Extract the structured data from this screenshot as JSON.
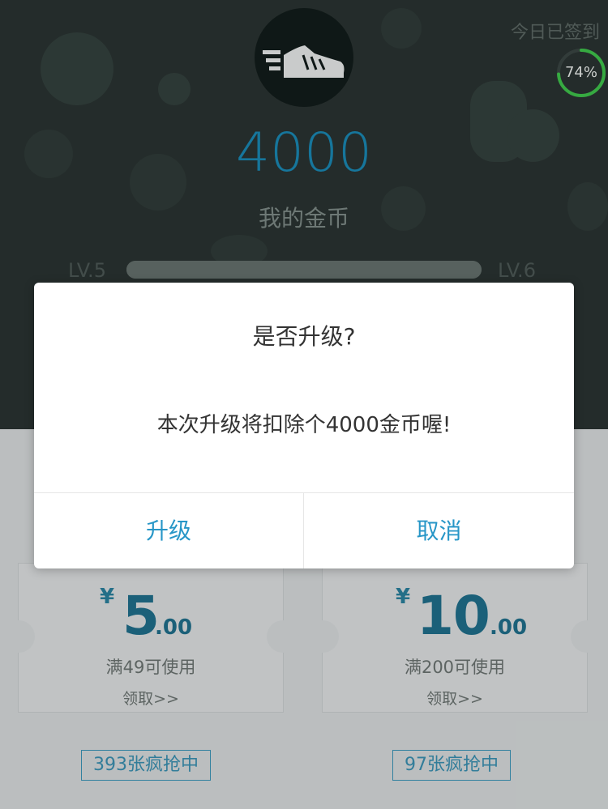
{
  "header": {
    "signin_status": "今日已签到",
    "progress_text": "74%",
    "progress": 0.74,
    "coins": "4000",
    "coins_label": "我的金币",
    "level_current": "LV.5",
    "level_next": "LV.6",
    "level_progress": 1.0
  },
  "coupons": [
    {
      "currency": "¥",
      "amount": "5",
      "cents": ".00",
      "condition": "满49可使用",
      "claim": "领取>>",
      "stock": "393张疯抢中"
    },
    {
      "currency": "¥",
      "amount": "10",
      "cents": ".00",
      "condition": "满200可使用",
      "claim": "领取>>",
      "stock": "97张疯抢中"
    }
  ],
  "dialog": {
    "title": "是否升级?",
    "message": "本次升级将扣除个4000金币喔!",
    "confirm_label": "升级",
    "cancel_label": "取消"
  },
  "colors": {
    "accent": "#2796c7",
    "coins": "#1a87b2",
    "ring": "#3ec24a"
  }
}
